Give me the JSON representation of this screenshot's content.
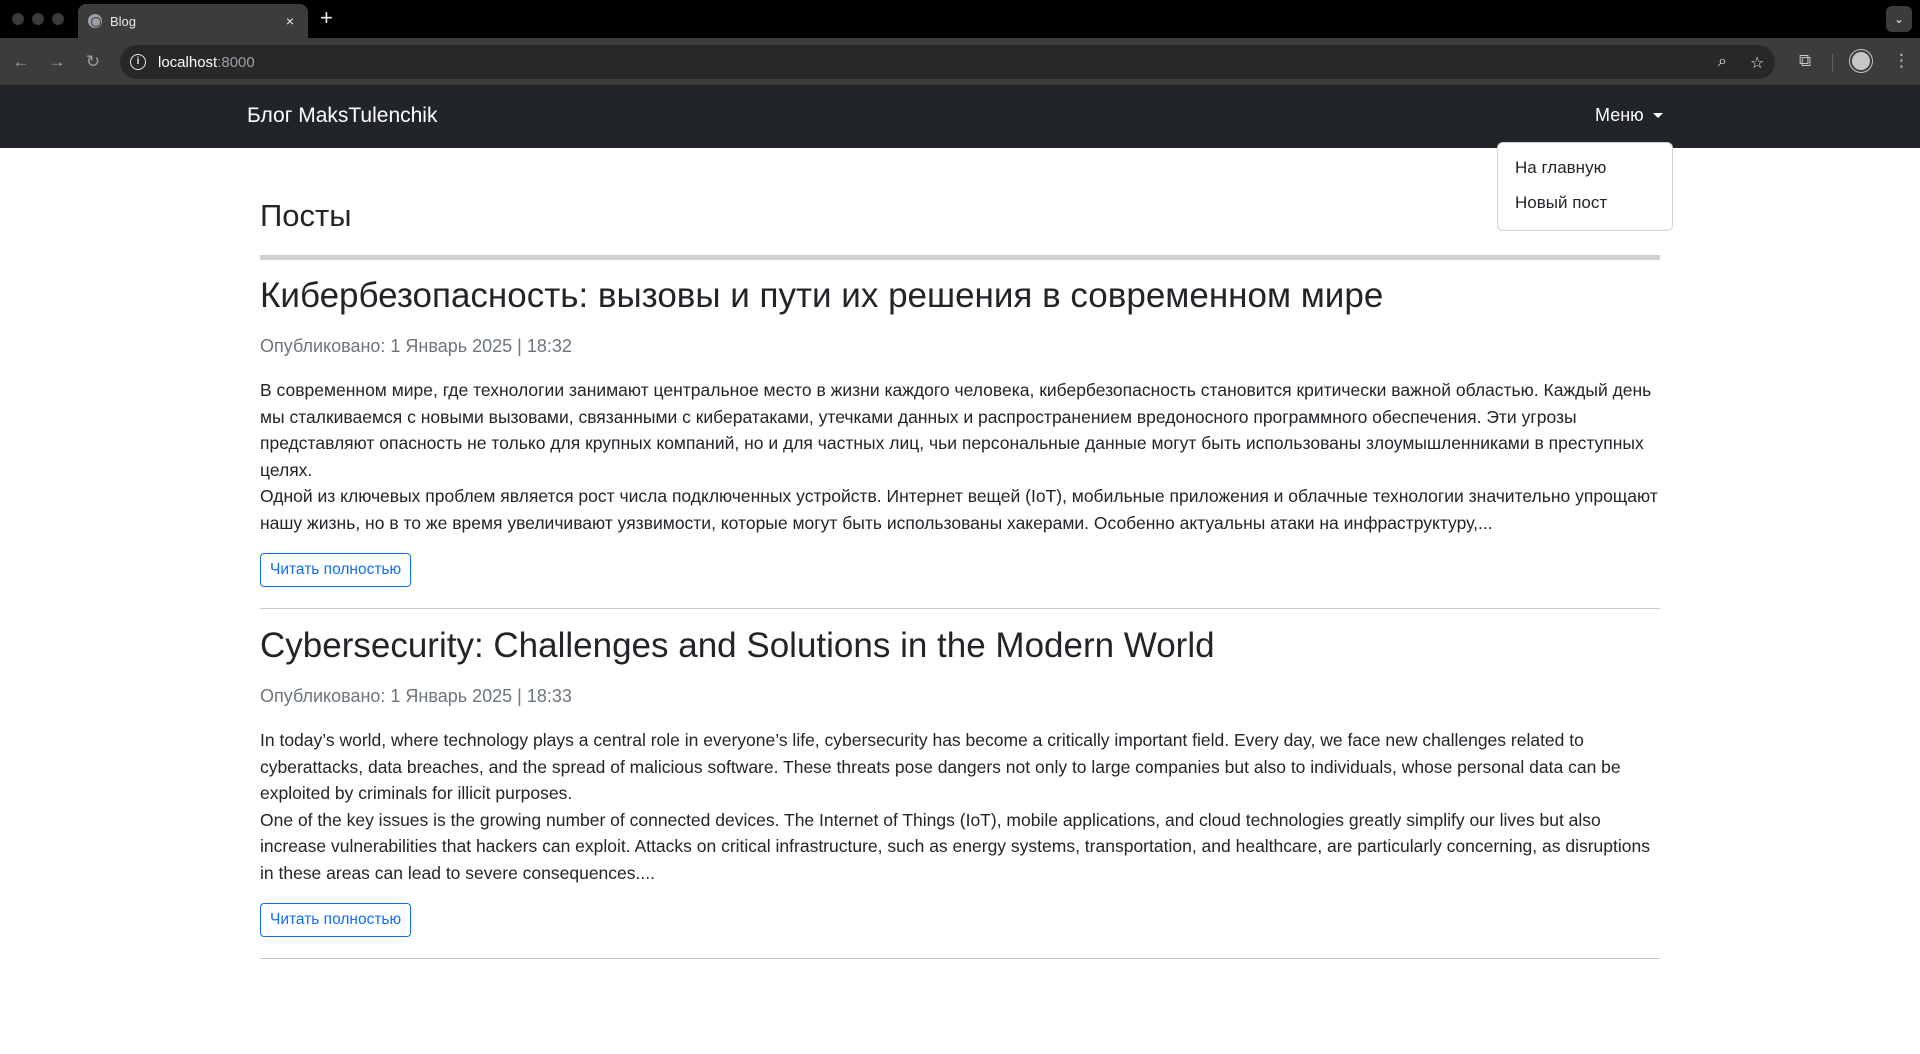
{
  "browser": {
    "tab_title": "Blog",
    "tab_close": "×",
    "new_tab": "+",
    "url_host": "localhost",
    "url_port": ":8000",
    "icons": [
      "back-arrow-icon",
      "forward-arrow-icon",
      "reload-icon",
      "site-info-icon",
      "zoom-icon",
      "bookmark-star-icon",
      "extensions-icon",
      "profile-icon",
      "more-menu-icon",
      "tab-search-icon"
    ]
  },
  "navbar": {
    "brand": "Блог MaksTulenchik",
    "menu_label": "Меню",
    "dropdown_items": [
      "На главную",
      "Новый пост"
    ]
  },
  "page": {
    "title": "Посты"
  },
  "posts": [
    {
      "title": "Кибербезопасность: вызовы и пути их решения в современном мире",
      "meta": "Опубликовано: 1 Январь 2025 | 18:32",
      "paragraphs": [
        "В современном мире, где технологии занимают центральное место в жизни каждого человека, кибербезопасность становится критически важной областью. Каждый день мы сталкиваемся с новыми вызовами, связанными с кибератаками, утечками данных и распространением вредоносного программного обеспечения. Эти угрозы представляют опасность не только для крупных компаний, но и для частных лиц, чьи персональные данные могут быть использованы злоумышленниками в преступных целях.",
        "Одной из ключевых проблем является рост числа подключенных устройств. Интернет вещей (IoT), мобильные приложения и облачные технологии значительно упрощают нашу жизнь, но в то же время увеличивают уязвимости, которые могут быть использованы хакерами. Особенно актуальны атаки на инфраструктуру,..."
      ],
      "button": "Читать полностью"
    },
    {
      "title": "Cybersecurity: Challenges and Solutions in the Modern World",
      "meta": "Опубликовано: 1 Январь 2025 | 18:33",
      "paragraphs": [
        "In today’s world, where technology plays a central role in everyone’s life, cybersecurity has become a critically important field. Every day, we face new challenges related to cyberattacks, data breaches, and the spread of malicious software. These threats pose dangers not only to large companies but also to individuals, whose personal data can be exploited by criminals for illicit purposes.",
        "One of the key issues is the growing number of connected devices. The Internet of Things (IoT), mobile applications, and cloud technologies greatly simplify our lives but also increase vulnerabilities that hackers can exploit. Attacks on critical infrastructure, such as energy systems, transportation, and healthcare, are particularly concerning, as disruptions in these areas can lead to severe consequences...."
      ],
      "button": "Читать полностью"
    }
  ],
  "colors": {
    "navbar_bg": "#212529",
    "button_accent": "#0d6efd",
    "meta_text": "#6c757d"
  }
}
